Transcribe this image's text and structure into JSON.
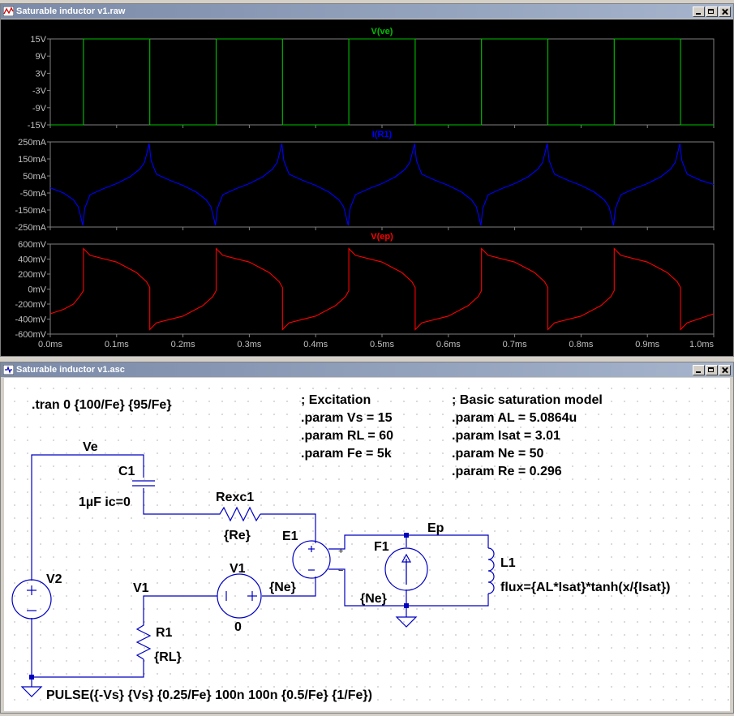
{
  "waveform_window": {
    "title": "Saturable inductor v1.raw",
    "icon": "waveform-app-icon"
  },
  "schematic_window": {
    "title": "Saturable inductor v1.asc",
    "icon": "schematic-app-icon"
  },
  "chart_data": [
    {
      "type": "line",
      "title": "V(ve)",
      "series": [
        {
          "name": "V(ve)",
          "color": "#00c000",
          "x": [
            0,
            0.05,
            0.05,
            0.15,
            0.15,
            0.25,
            0.25,
            0.35,
            0.35,
            0.45,
            0.45,
            0.55,
            0.55,
            0.65,
            0.65,
            0.75,
            0.75,
            0.85,
            0.85,
            0.95,
            0.95,
            1.0
          ],
          "values": [
            -15,
            -15,
            15,
            15,
            -15,
            -15,
            15,
            15,
            -15,
            -15,
            15,
            15,
            -15,
            -15,
            15,
            15,
            -15,
            -15,
            15,
            15,
            -15,
            -15
          ]
        }
      ],
      "ylim": [
        -15,
        15
      ],
      "ytick_labels": [
        "15V",
        "9V",
        "3V",
        "-3V",
        "-9V",
        "-15V"
      ],
      "ytick_values": [
        15,
        9,
        3,
        -3,
        -9,
        -15
      ]
    },
    {
      "type": "line",
      "title": "I(R1)",
      "series": [
        {
          "name": "I(R1)",
          "color": "#0000ff",
          "x": [
            0,
            0.02,
            0.035,
            0.042,
            0.046,
            0.049,
            0.052,
            0.06,
            0.08,
            0.1,
            0.12,
            0.135,
            0.142,
            0.146,
            0.149,
            0.152,
            0.16,
            0.18,
            0.2,
            0.22,
            0.235,
            0.242,
            0.246,
            0.249,
            0.252,
            0.26,
            0.28,
            0.3,
            0.32,
            0.335,
            0.342,
            0.346,
            0.349,
            0.352,
            0.36,
            0.38,
            0.4,
            0.42,
            0.435,
            0.442,
            0.446,
            0.449,
            0.452,
            0.46,
            0.48,
            0.5,
            0.52,
            0.535,
            0.542,
            0.546,
            0.549,
            0.552,
            0.56,
            0.58,
            0.6,
            0.62,
            0.635,
            0.642,
            0.646,
            0.649,
            0.652,
            0.66,
            0.68,
            0.7,
            0.72,
            0.735,
            0.742,
            0.746,
            0.749,
            0.752,
            0.76,
            0.78,
            0.8,
            0.82,
            0.835,
            0.842,
            0.846,
            0.849,
            0.852,
            0.86,
            0.88,
            0.9,
            0.92,
            0.935,
            0.942,
            0.946,
            0.949,
            0.952,
            0.96,
            0.98,
            1.0
          ],
          "values": [
            -20,
            -50,
            -90,
            -130,
            -190,
            -240,
            -140,
            -60,
            -25,
            5,
            45,
            90,
            130,
            190,
            240,
            140,
            60,
            25,
            -5,
            -45,
            -90,
            -130,
            -190,
            -240,
            -140,
            -60,
            -25,
            5,
            45,
            90,
            130,
            190,
            240,
            140,
            60,
            25,
            -5,
            -45,
            -90,
            -130,
            -190,
            -240,
            -140,
            -60,
            -25,
            5,
            45,
            90,
            130,
            190,
            240,
            140,
            60,
            25,
            -5,
            -45,
            -90,
            -130,
            -190,
            -240,
            -140,
            -60,
            -25,
            5,
            45,
            90,
            130,
            190,
            240,
            140,
            60,
            25,
            -5,
            -45,
            -90,
            -130,
            -190,
            -240,
            -140,
            -60,
            -25,
            5,
            45,
            90,
            130,
            190,
            240,
            140,
            60,
            25,
            0
          ]
        }
      ],
      "ylim": [
        -250,
        250
      ],
      "ytick_labels": [
        "250mA",
        "150mA",
        "50mA",
        "-50mA",
        "-150mA",
        "-250mA"
      ],
      "ytick_values": [
        250,
        150,
        50,
        -50,
        -150,
        -250
      ]
    },
    {
      "type": "line",
      "title": "V(ep)",
      "series": [
        {
          "name": "V(ep)",
          "color": "#ff0000",
          "x": [
            0,
            0.02,
            0.035,
            0.044,
            0.05,
            0.05,
            0.06,
            0.1,
            0.13,
            0.145,
            0.15,
            0.15,
            0.16,
            0.2,
            0.23,
            0.245,
            0.25,
            0.25,
            0.26,
            0.3,
            0.33,
            0.345,
            0.35,
            0.35,
            0.36,
            0.4,
            0.43,
            0.445,
            0.45,
            0.45,
            0.46,
            0.5,
            0.53,
            0.545,
            0.55,
            0.55,
            0.56,
            0.6,
            0.63,
            0.645,
            0.65,
            0.65,
            0.66,
            0.7,
            0.73,
            0.745,
            0.75,
            0.75,
            0.76,
            0.8,
            0.83,
            0.845,
            0.85,
            0.85,
            0.86,
            0.9,
            0.93,
            0.945,
            0.95,
            0.95,
            0.96,
            1.0
          ],
          "values": [
            -330,
            -270,
            -200,
            -100,
            -20,
            540,
            450,
            360,
            220,
            100,
            20,
            -540,
            -450,
            -360,
            -220,
            -100,
            -20,
            540,
            450,
            360,
            220,
            100,
            20,
            -540,
            -450,
            -360,
            -220,
            -100,
            -20,
            540,
            450,
            360,
            220,
            100,
            20,
            -540,
            -450,
            -360,
            -220,
            -100,
            -20,
            540,
            450,
            360,
            220,
            100,
            20,
            -540,
            -450,
            -360,
            -220,
            -100,
            -20,
            540,
            450,
            360,
            220,
            100,
            20,
            -540,
            -450,
            -330
          ]
        }
      ],
      "ylim": [
        -600,
        600
      ],
      "ytick_labels": [
        "600mV",
        "400mV",
        "200mV",
        "0mV",
        "-200mV",
        "-400mV",
        "-600mV"
      ],
      "ytick_values": [
        600,
        400,
        200,
        0,
        -200,
        -400,
        -600
      ]
    }
  ],
  "x_axis": {
    "range": [
      0,
      1.0
    ],
    "tick_labels": [
      "0.0ms",
      "0.1ms",
      "0.2ms",
      "0.3ms",
      "0.4ms",
      "0.5ms",
      "0.6ms",
      "0.7ms",
      "0.8ms",
      "0.9ms",
      "1.0ms"
    ]
  },
  "schematic": {
    "directive_tran": ".tran 0 {100/Fe} {95/Fe}",
    "excitation_lines": [
      "; Excitation",
      ".param Vs  = 15",
      ".param RL = 60",
      ".param Fe  = 5k"
    ],
    "saturation_lines": [
      "; Basic saturation model",
      ".param AL = 5.0864u",
      ".param Isat = 3.01",
      ".param Ne = 50",
      ".param Re = 0.296"
    ],
    "labels": {
      "ve": "Ve",
      "c1": "C1",
      "c1_value": "1µF ic=0",
      "rexc1": "Rexc1",
      "rexc1_value": "{Re}",
      "e1": "E1",
      "e1_value": "{Ne}",
      "v1_source": "V1",
      "v1_value": "0",
      "v1_net": "V1",
      "v2": "V2",
      "r1": "R1",
      "r1_value": "{RL}",
      "ep": "Ep",
      "f1": "F1",
      "f1_value": "{Ne}",
      "l1": "L1",
      "l1_value": "flux={AL*Isat}*tanh(x/{Isat})",
      "pulse": "PULSE({-Vs} {Vs} {0.25/Fe} 100n 100n {0.5/Fe} {1/Fe})",
      "plus": "+",
      "minus": "−"
    },
    "colors": {
      "wire": "#0000c0",
      "text": "#000000",
      "grid_dot": "#7a7a7a"
    }
  }
}
